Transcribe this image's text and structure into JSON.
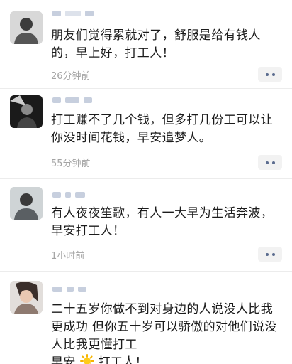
{
  "feed": {
    "posts": [
      {
        "text": "朋友们觉得累就对了，舒服是给有钱人\n的，早上好，打工人！",
        "time": "26分钟前"
      },
      {
        "text": "打工赚不了几个钱，但多打几份工可以让\n你没时间花钱，早安追梦人。",
        "time": "55分钟前"
      },
      {
        "text": "有人夜夜笙歌，有人一大早为生活奔波，\n早安打工人！",
        "time": "1小时前"
      },
      {
        "text_lines": [
          "二十五岁你做不到对身边的人说没人比我",
          "更成功 但你五十岁可以骄傲的对他们说没",
          "人比我更懂打工"
        ],
        "text_last_prefix": "早安",
        "text_last_suffix": "打工人！"
      }
    ]
  },
  "icons": {
    "more": "more-dots-icon",
    "sun": "sun-emoji-icon"
  },
  "colors": {
    "text": "#1b1b1b",
    "time": "#a4a4a4",
    "more_dots": "#5b6c8f",
    "more_bg": "#f2f2f2"
  }
}
